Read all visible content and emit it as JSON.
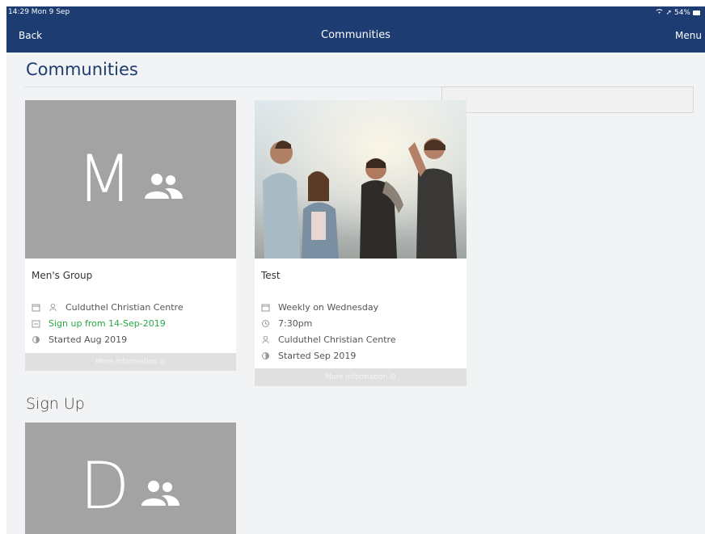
{
  "status_bar": {
    "time": "14:29  Mon 9 Sep",
    "battery": "54%"
  },
  "nav": {
    "back_label": "Back",
    "title": "Communities",
    "menu_label": "Menu"
  },
  "page": {
    "title": "Communities",
    "search": {
      "placeholder": ""
    }
  },
  "cards": [
    {
      "initial": "M",
      "name": "Men's Group",
      "info": [
        {
          "icon": "calendar-icon",
          "text": ""
        },
        {
          "icon": "location-icon",
          "text": "Culduthel Christian Centre"
        },
        {
          "icon": "signup-icon",
          "text": "Sign up from 14-Sep-2019",
          "color": "#28a745"
        },
        {
          "icon": "started-icon",
          "text": "Started Aug 2019"
        }
      ],
      "more_label": "More information ⊙"
    },
    {
      "image": "photo of group of friends",
      "name": "Test",
      "info": [
        {
          "icon": "calendar-icon",
          "text": "Weekly on Wednesday"
        },
        {
          "icon": "clock-icon",
          "text": "7:30pm"
        },
        {
          "icon": "location-icon",
          "text": "Culduthel Christian Centre"
        },
        {
          "icon": "started-icon",
          "text": "Started Sep 2019"
        }
      ],
      "more_label": "More information ⊙"
    }
  ],
  "sign_up": {
    "title": "Sign Up",
    "cards": [
      {
        "initial": "D"
      }
    ]
  },
  "colors": {
    "nav": "#1d3c72",
    "placeholder_tile": "#a3a3a3",
    "signup_green": "#28a745"
  }
}
